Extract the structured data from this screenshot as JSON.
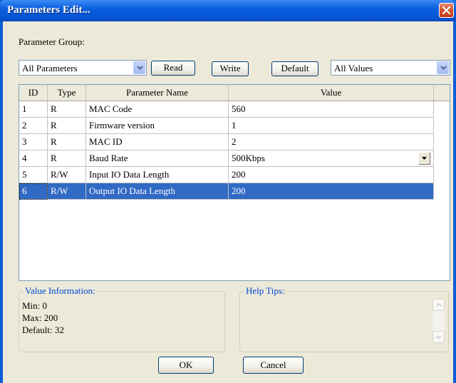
{
  "window": {
    "title": "Parameters Edit..."
  },
  "group_label": "Parameter Group:",
  "group_select": {
    "value": "All Parameters"
  },
  "toolbar": {
    "read": "Read",
    "write": "Write",
    "default": "Default"
  },
  "values_select": {
    "value": "All Values"
  },
  "table": {
    "headers": [
      "ID",
      "Type",
      "Parameter Name",
      "Value"
    ],
    "rows": [
      {
        "id": "1",
        "type": "R",
        "name": "MAC Code",
        "value": "560"
      },
      {
        "id": "2",
        "type": "R",
        "name": "Firmware version",
        "value": "1"
      },
      {
        "id": "3",
        "type": "R",
        "name": "MAC ID",
        "value": "2"
      },
      {
        "id": "4",
        "type": "R",
        "name": "Baud Rate",
        "value": "500Kbps"
      },
      {
        "id": "5",
        "type": "R/W",
        "name": "Input IO Data Length",
        "value": "200"
      },
      {
        "id": "6",
        "type": "R/W",
        "name": "Output IO Data Length",
        "value": "200"
      }
    ],
    "selected_row": 6
  },
  "value_info": {
    "title": "Value Information:",
    "min": "Min: 0",
    "max": "Max: 200",
    "default": "Default: 32"
  },
  "help_tips": {
    "title": "Help Tips:"
  },
  "dialog": {
    "ok": "OK",
    "cancel": "Cancel"
  },
  "colors": {
    "title_bar": "#0a5fe0",
    "selection": "#316ac5",
    "group_title": "#0046d5",
    "dialog_bg": "#ece9d8"
  }
}
